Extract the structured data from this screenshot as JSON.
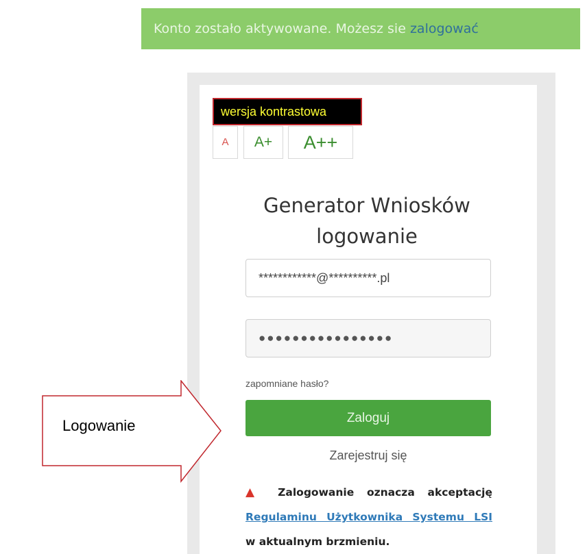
{
  "banner": {
    "message": "Konto zostało aktywowane. Możesz sie ",
    "link": "zalogować"
  },
  "accessibility": {
    "contrast_label": "wersja kontrastowa",
    "font_small": "A",
    "font_medium": "A+",
    "font_large": "A++"
  },
  "login": {
    "title_line1": "Generator Wniosków",
    "title_line2": "logowanie",
    "email_value": "************@**********.pl",
    "password_value": "●●●●●●●●●●●●●●●●",
    "forgot_password": "zapomniane hasło?",
    "login_button": "Zaloguj",
    "register_link": "Zarejestruj się"
  },
  "notice": {
    "icon": "warning-triangle-icon",
    "text_before": "Zalogowanie oznacza akceptację",
    "link_text": "Regulaminu Użytkownika Systemu LSI",
    "text_after": "w aktualnym brzmieniu."
  },
  "annotation": {
    "arrow_label": "Logowanie"
  },
  "colors": {
    "banner_bg": "#8ccc6a",
    "button_green": "#4aa53f",
    "link_blue": "#2f7ab8",
    "arrow_red": "#c0272d"
  }
}
